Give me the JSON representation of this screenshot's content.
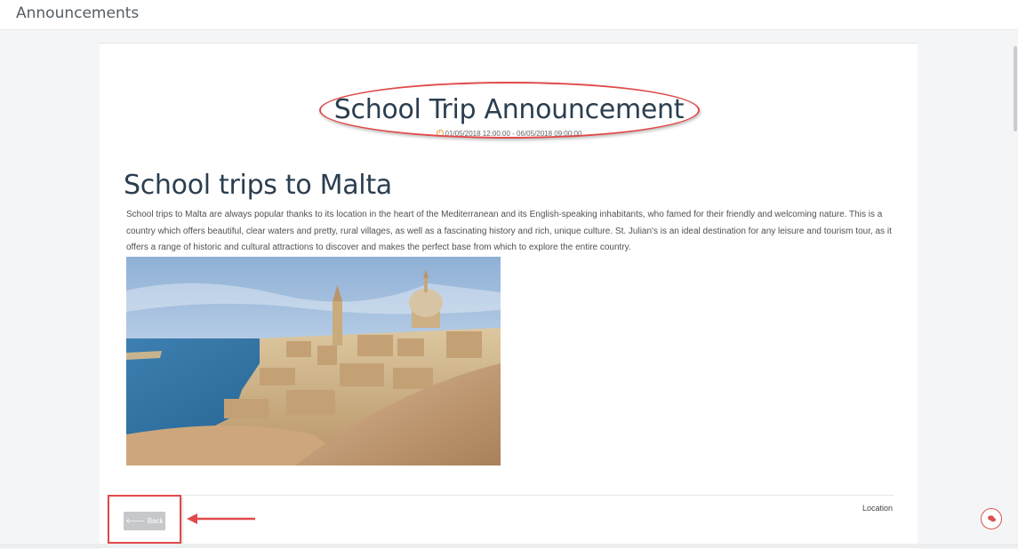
{
  "header": {
    "title": "Announcements"
  },
  "announcement": {
    "title": "School Trip Announcement",
    "date_range": "01/05/2018 12:00:00 - 06/05/2018 09:00:00"
  },
  "article": {
    "heading": "School trips to Malta",
    "body": "School trips to Malta are always popular thanks to its location in the heart of the Mediterranean and its English-speaking inhabitants, who famed for their friendly and welcoming nature. This is a country which offers beautiful, clear waters and pretty, rural villages, as well as a fascinating history and rich, unique culture. St. Julian's is an ideal destination for any leisure and tourism tour, as it offers a range of historic and cultural attractions to discover and makes the perfect base from which to explore the entire country."
  },
  "footer": {
    "back_label": "Back",
    "location_label": "Location"
  },
  "icons": {
    "date": "clock-icon",
    "back": "arrow-left-icon",
    "chat": "chat-bubble-icon"
  },
  "colors": {
    "heading": "#2b3e50",
    "annotation": "#e04a4a",
    "back_button": "#c6c8cb",
    "clock": "#f0a030"
  }
}
